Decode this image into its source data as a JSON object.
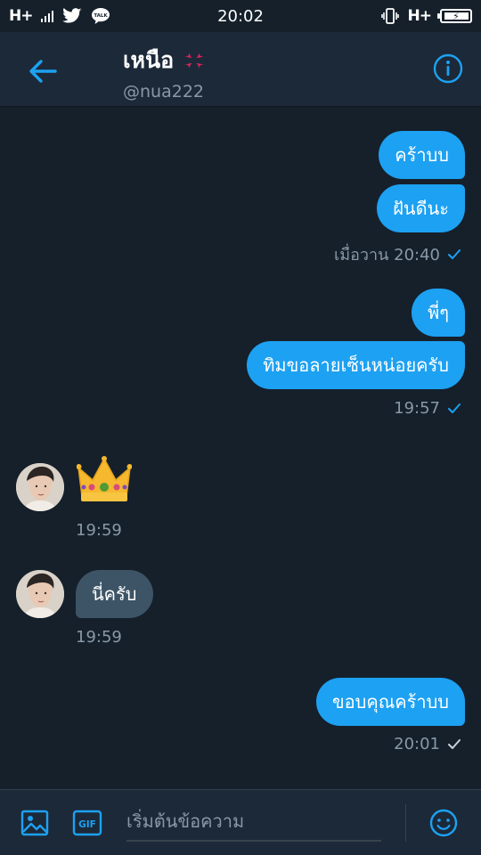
{
  "status_bar": {
    "network_label": "H+",
    "time": "20:02",
    "right_network_label": "H+"
  },
  "header": {
    "title": "เหนือ",
    "handle": "@nua222",
    "title_emoji_icon": "anger-symbol-icon"
  },
  "messages": [
    {
      "direction": "outgoing",
      "text": "คร้าบบ"
    },
    {
      "direction": "outgoing",
      "text": "ฝันดีนะ"
    },
    {
      "meta": "เมื่อวาน 20:40",
      "status": "sent-check-icon"
    },
    {
      "direction": "outgoing",
      "text": "พี่ๆ"
    },
    {
      "direction": "outgoing",
      "text": "ทิมขอลายเซ็นหน่อยครับ"
    },
    {
      "meta": "19:57",
      "status": "sent-check-icon"
    },
    {
      "direction": "incoming",
      "emoji": "crown-icon"
    },
    {
      "meta": "19:59"
    },
    {
      "direction": "incoming",
      "text": "นี่ครับ"
    },
    {
      "meta": "19:59"
    },
    {
      "direction": "outgoing",
      "text": "ขอบคุณคร้าบบ"
    },
    {
      "meta": "20:01",
      "status": "sent-check-icon"
    }
  ],
  "compose": {
    "placeholder": "เริ่มต้นข้อความ",
    "value": ""
  },
  "colors": {
    "background": "#15202b",
    "header": "#1c2938",
    "accent": "#1da1f2",
    "incoming_bubble": "#3d5466",
    "secondary_text": "#8899a6"
  }
}
